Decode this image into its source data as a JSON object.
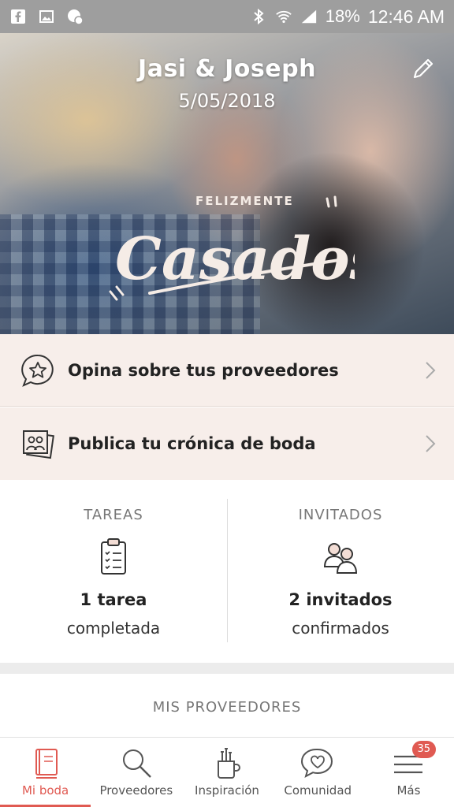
{
  "status_bar": {
    "battery": "18%",
    "time": "12:46 AM",
    "icons": [
      "facebook-icon",
      "gallery-icon",
      "messenger-icon",
      "bluetooth-icon",
      "wifi-icon",
      "signal-icon"
    ]
  },
  "hero": {
    "couple": "Jasi & Joseph",
    "date": "5/05/2018",
    "stamp_small": "FELIZMENTE",
    "stamp_big": "Casados"
  },
  "actions": [
    {
      "label": "Opina sobre tus proveedores",
      "icon": "star-chat-icon"
    },
    {
      "label": "Publica tu crónica de boda",
      "icon": "photos-icon"
    }
  ],
  "stats": {
    "tasks": {
      "title": "TAREAS",
      "count": "1 tarea",
      "status": "completada",
      "icon": "clipboard-icon"
    },
    "guests": {
      "title": "INVITADOS",
      "count": "2 invitados",
      "status": "confirmados",
      "icon": "guests-icon"
    }
  },
  "providers": {
    "title": "MIS PROVEEDORES"
  },
  "nav": {
    "items": [
      {
        "label": "Mi boda",
        "icon": "book-icon",
        "active": true
      },
      {
        "label": "Proveedores",
        "icon": "search-icon"
      },
      {
        "label": "Inspiración",
        "icon": "brushes-icon"
      },
      {
        "label": "Comunidad",
        "icon": "heart-chat-icon"
      },
      {
        "label": "Más",
        "icon": "menu-icon",
        "badge": "35"
      }
    ]
  },
  "colors": {
    "accent": "#e05a52",
    "row_bg": "#f7eeea",
    "status_bar": "#9e9e9e"
  }
}
